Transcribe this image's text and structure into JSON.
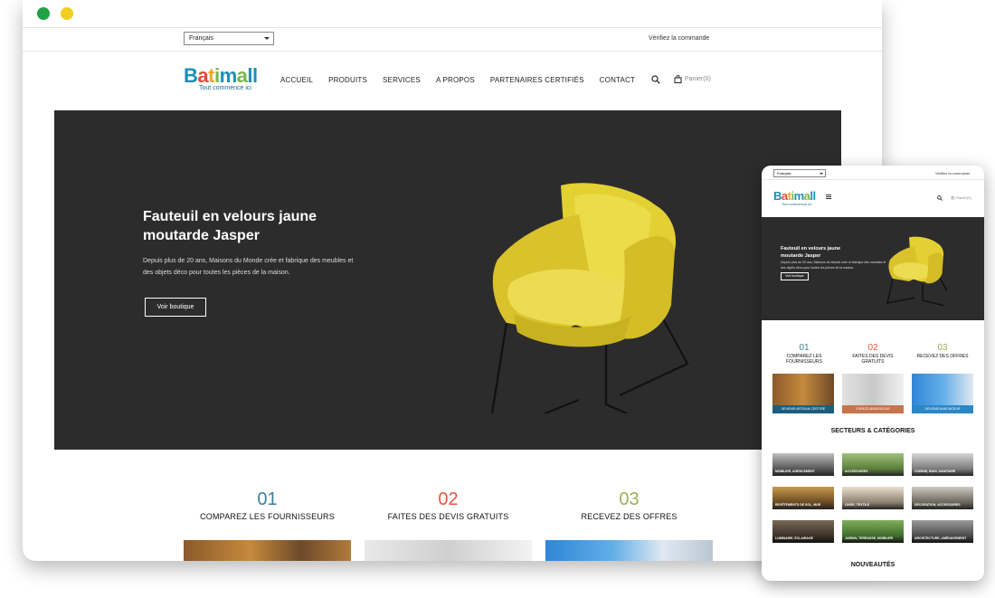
{
  "desktop": {
    "language": "Français",
    "verify_order": "Vérifiez la commande",
    "logo": {
      "text": "Batimall",
      "tagline": "Tout commence ici"
    },
    "nav": [
      "ACCUEIL",
      "PRODUITS",
      "SERVICES",
      "A PROPOS",
      "PARTENAIRES CERTIFIÉS",
      "CONTACT"
    ],
    "cart": "Panier(0)",
    "hero": {
      "title_line1": "Fauteuil en velours jaune",
      "title_line2": "moutarde Jasper",
      "text": "Depuis plus de 20 ans, Maisons du Monde crée et fabrique des meubles et des objets déco pour toutes les pièces de la maison.",
      "button": "Voir boutique"
    },
    "steps": [
      {
        "num": "01",
        "label": "COMPAREZ LES FOURNISSEURS",
        "color": "#3d7f9b"
      },
      {
        "num": "02",
        "label": "FAITES DES DEVIS GRATUITS",
        "color": "#e8553c"
      },
      {
        "num": "03",
        "label": "RECEVEZ DES OFFRES",
        "color": "#9bb058"
      }
    ]
  },
  "mobile": {
    "language": "Français",
    "verify_order": "Vérifiez la commande",
    "logo": {
      "text": "Batimall",
      "tagline": "Tout commence ici"
    },
    "cart": "Panier(0)",
    "hero": {
      "title": "Fauteuil en velours jaune moutarde Jasper",
      "text": "Depuis plus de 20 ans, Maisons du Monde crée et fabrique des meubles et des objets déco pour toutes les pièces de la maison.",
      "button": "Voir boutique"
    },
    "steps": [
      {
        "num": "01",
        "label": "COMPAREZ LES FOURNISSEURS",
        "color": "#3d7f9b",
        "card": "DEVENIR ARTISAN CERTIFIÉ",
        "card_color": "#1d5e7d"
      },
      {
        "num": "02",
        "label": "FAITES DES DEVIS GRATUITS",
        "color": "#e8553c",
        "card": "ESPACE ANNONCEUR",
        "card_color": "#c8734a"
      },
      {
        "num": "03",
        "label": "RECEVEZ DES OFFRES",
        "color": "#9bb058",
        "card": "DEVENIR ANNONCEUR",
        "card_color": "#2a87c8"
      }
    ],
    "sectors_title": "SECTEURS & CATÉGORIES",
    "sectors": [
      "MOBILIER, AGENCEMENT",
      "ACCESSOIRES",
      "CUISINE, BAIN, SANITAIRE",
      "REVÊTEMENTS DE SOL, MUR",
      "LINGE, TEXTILE",
      "DÉCORATION, ACCESSOIRES",
      "LUMINAIRE, ÉCLAIRAGE",
      "JARDIN, TERRASSE, MOBILIER",
      "ARCHITECTURE, AMÉNAGEMENT"
    ],
    "new_title": "NOUVEAUTÉS"
  }
}
